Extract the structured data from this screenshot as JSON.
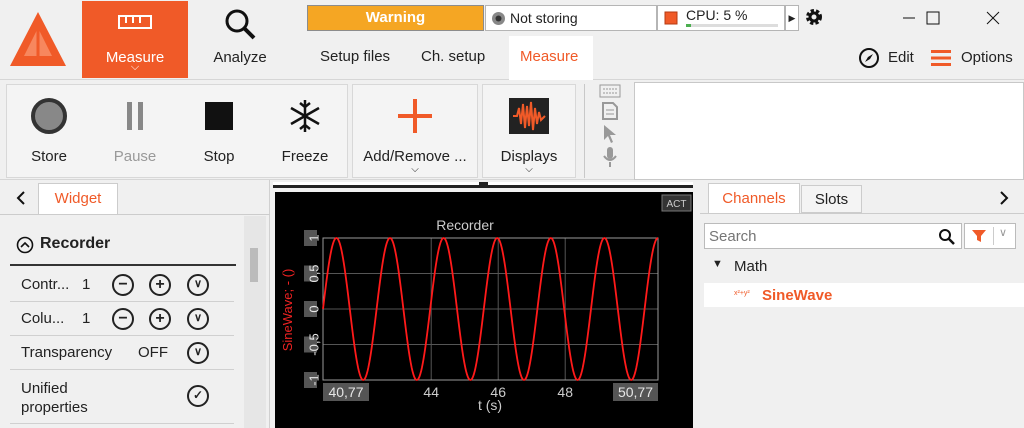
{
  "topbar": {
    "measure_label": "Measure",
    "analyze_label": "Analyze",
    "warning": "Warning",
    "store_status": "Not storing",
    "cpu": "CPU: 5 %",
    "cpu_usage": 0.05
  },
  "tabs": {
    "setup_files": "Setup files",
    "ch_setup": "Ch. setup",
    "measure": "Measure",
    "edit": "Edit",
    "options": "Options"
  },
  "ribbon": {
    "store": "Store",
    "pause": "Pause",
    "stop": "Stop",
    "freeze": "Freeze",
    "add_remove": "Add/Remove ...",
    "displays": "Displays"
  },
  "widget": {
    "tab": "Widget",
    "section": "Recorder",
    "rows": [
      {
        "name": "Contr...",
        "value": "1"
      },
      {
        "name": "Colu...",
        "value": "1"
      },
      {
        "name": "Transparency",
        "value": "OFF"
      },
      {
        "name": "Unified properties",
        "value": ""
      }
    ]
  },
  "plot": {
    "act": "ACT"
  },
  "chart_data": {
    "type": "line",
    "title": "Recorder",
    "xlabel": "t (s)",
    "ylabel": "SineWave; - ()",
    "xlim": [
      40.77,
      50.77
    ],
    "ylim": [
      -1,
      1
    ],
    "xticks": [
      "44",
      "46",
      "48"
    ],
    "x_min_label": "40,77",
    "x_max_label": "50,77",
    "yticks": [
      "1",
      "0,5",
      "0",
      "-0,5",
      "-1"
    ],
    "series": [
      {
        "name": "SineWave",
        "color": "#ff1a1a",
        "function": "sin",
        "period": 1.6,
        "amplitude": 1
      }
    ],
    "grid": true
  },
  "channels": {
    "tab_channels": "Channels",
    "tab_slots": "Slots",
    "search_placeholder": "Search",
    "group": "Math",
    "item_prefix": "x²+y²",
    "item": "SineWave"
  }
}
